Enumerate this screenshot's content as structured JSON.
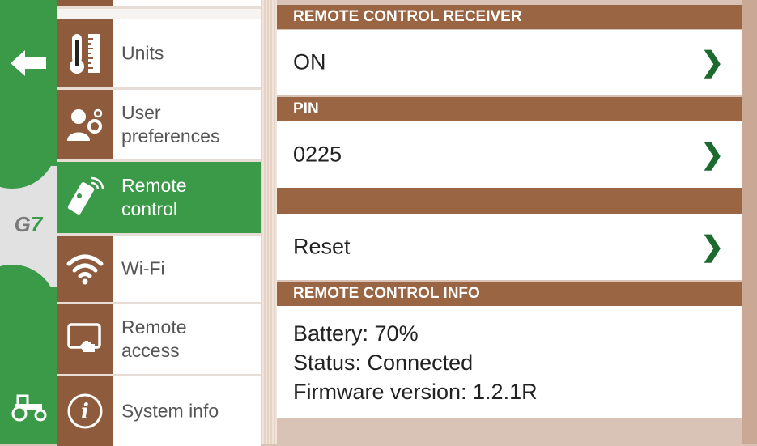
{
  "rail": {
    "back_glyph": "🡐",
    "logo": {
      "letter": "G",
      "digit": "7"
    }
  },
  "menu": {
    "items": [
      {
        "label": "",
        "icon": "partial-icon"
      },
      {
        "label": "Units",
        "icon": "thermometer-ruler-icon"
      },
      {
        "label": "User\npreferences",
        "icon": "user-gear-icon"
      },
      {
        "label": "Remote\ncontrol",
        "icon": "remote-control-icon",
        "active": true
      },
      {
        "label": "Wi-Fi",
        "icon": "wifi-icon"
      },
      {
        "label": "Remote\naccess",
        "icon": "tablet-touch-icon"
      },
      {
        "label": "System info",
        "icon": "info-icon"
      }
    ]
  },
  "content": {
    "receiver_header": "REMOTE CONTROL RECEIVER",
    "receiver_value": "ON",
    "pin_header": "PIN",
    "pin_value": "0225",
    "reset_label": "Reset",
    "info_header": "REMOTE CONTROL INFO",
    "battery": "Battery: 70%",
    "status": "Status: Connected",
    "firmware": "Firmware version: 1.2.1R",
    "chevron": "❯"
  },
  "colors": {
    "green": "#3a9a48",
    "brown": "#9a6543",
    "chevron": "#1d6a2f"
  }
}
